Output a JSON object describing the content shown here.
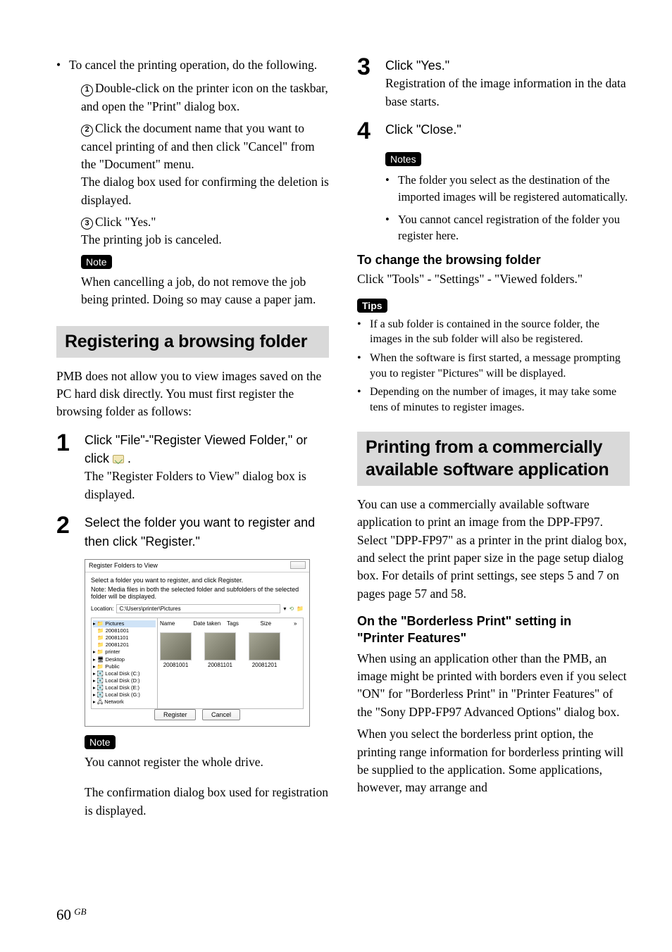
{
  "left": {
    "top_bullet": "To cancel the printing operation, do the following.",
    "sub1": "Double-click on the printer icon on the taskbar, and open the \"Print\" dialog box.",
    "sub2a": "Click the document name that you want to cancel printing of and then click \"Cancel\" from the \"Document\" menu.",
    "sub2b": "The dialog box used for confirming the deletion is displayed.",
    "sub3a": "Click \"Yes.\"",
    "sub3b": "The printing job is canceled.",
    "note_label": "Note",
    "note_text": "When cancelling a job, do not remove the job being printed. Doing so may cause a paper jam.",
    "heading1": "Registering a browsing folder",
    "intro": "PMB does not allow you to view images saved on the PC hard disk directly. You must first register the browsing folder as follows:",
    "step1_instr": "Click \"File\"-\"Register Viewed Folder,\" or click ",
    "step1_instr_end": " .",
    "step1_body": "The \"Register Folders to View\" dialog box is displayed.",
    "step2_instr": "Select the folder you want to register and then click \"Register.\"",
    "note2_label": "Note",
    "note2_text": "You cannot register the whole drive.",
    "confirm_text": "The confirmation dialog box used for registration is displayed."
  },
  "dialog": {
    "title": "Register Folders to View",
    "line1": "Select a folder you want to register, and click Register.",
    "line2": "Note: Media files in both the selected folder and subfolders of the selected folder will be displayed.",
    "loc_label": "Location:",
    "loc_value": "C:\\Users\\printer\\Pictures",
    "tree": [
      "Pictures",
      "  20081001",
      "  20081101",
      "  20081201",
      "printer",
      "Desktop",
      "Public",
      "Local Disk (C:)",
      "Local Disk (D:)",
      "Local Disk (E:)",
      "Local Disk (G:)",
      "Network"
    ],
    "cols": [
      "Name",
      "Date taken",
      "Tags",
      "Size"
    ],
    "thumbs": [
      "20081001",
      "20081101",
      "20081201"
    ],
    "btn_register": "Register",
    "btn_cancel": "Cancel"
  },
  "right": {
    "step3_instr": "Click \"Yes.\"",
    "step3_body": "Registration of the image information in the data base starts.",
    "step4_instr": "Click \"Close.\"",
    "notes_label": "Notes",
    "notes_b1": "The folder you select as the destination of the imported images will be registered automatically.",
    "notes_b2": "You cannot cancel registration of the folder you register here.",
    "change_head": "To change the browsing folder",
    "change_body": "Click \"Tools\" - \"Settings\" - \"Viewed folders.\"",
    "tips_label": "Tips",
    "tip1": "If a sub folder is contained in the source folder, the images in the sub folder will also be registered.",
    "tip2": "When the software is first started, a message prompting you to register \"Pictures\" will be displayed.",
    "tip3": "Depending on the number of images, it may take some tens of minutes to register images.",
    "heading2a": "Printing from a commercially",
    "heading2b": "available software application",
    "comm_body": "You can use a commercially available software application to print an image from the DPP-FP97. Select \"DPP-FP97\" as a printer in the print dialog box, and select the print paper size in the page setup dialog box. For details of print settings, see steps 5 and 7 on pages page 57 and 58.",
    "borderless_head1": "On the \"Borderless Print\" setting in",
    "borderless_head2": "\"Printer Features\"",
    "borderless_p1": "When using an application other than the PMB, an image might be printed with borders even if you select \"ON\" for  \"Borderless Print\" in \"Printer Features\" of the \"Sony DPP-FP97 Advanced Options\" dialog box.",
    "borderless_p2": "When you select the borderless print option, the printing range information for borderless printing will be supplied to the application. Some applications, however, may arrange and"
  },
  "footer": {
    "page": "60",
    "region": "GB"
  }
}
